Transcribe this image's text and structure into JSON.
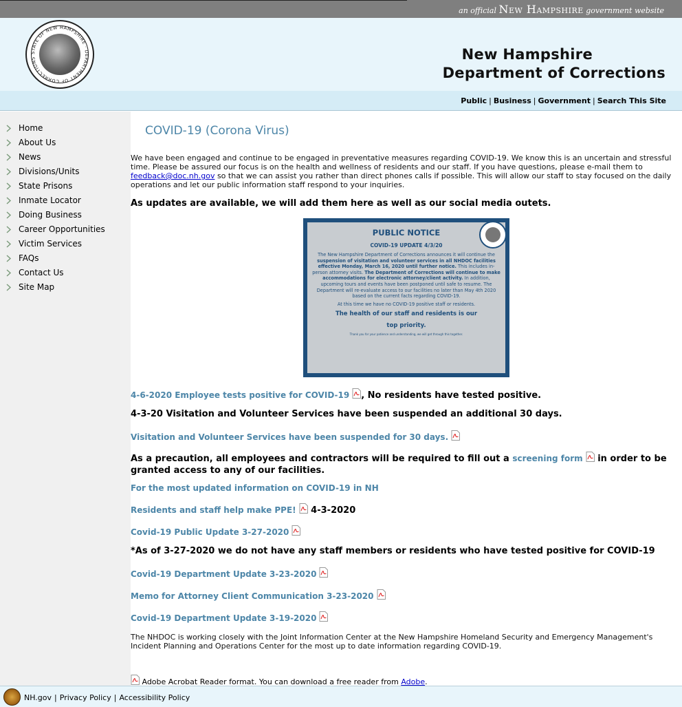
{
  "topbar": {
    "prefix": "an official",
    "state": "New Hampshire",
    "suffix": "government website"
  },
  "header": {
    "title_line1": "New Hampshire",
    "title_line2": "Department of Corrections",
    "seal_text": "STATE OF NEW HAMPSHIRE · DEPARTMENT OF CORRECTIONS"
  },
  "topnav": [
    "Public",
    "Business",
    "Government",
    "Search This Site"
  ],
  "sidebar": {
    "items": [
      "Home",
      "About Us",
      "News",
      "Divisions/Units",
      "State Prisons",
      "Inmate Locator",
      "Doing Business",
      "Career Opportunities",
      "Victim Services",
      "FAQs",
      "Contact Us",
      "Site Map"
    ]
  },
  "main": {
    "title": "COVID-19 (Corona Virus)",
    "intro_before": "We have been engaged and continue to be engaged in preventative measures regarding COVID-19. We know this is an uncertain and stressful time. Please be assured our focus is on the health and wellness of residents and our staff. If you have questions, please e-mail them to ",
    "intro_email": "feedback@doc.nh.gov",
    "intro_after": " so that we can assist you rather than direct phones calls if possible. This will allow our staff to stay focused on the daily operations and let our public information staff respond to your inquiries.",
    "updates_heading": "As updates are available, we will add them here as well as our social media outets.",
    "notice": {
      "title": "PUBLIC NOTICE",
      "update": "COVID-19 UPDATE 4/3/20",
      "p1_a": "The New Hampshire Department of Corrections announces it will continue the ",
      "p1_b": "suspension of visitation and volunteer services in all NHDOC facilities effective Monday, March 16, 2020 until further notice.",
      "p1_c": " This includes in-person attorney visits. ",
      "p1_d": "The Department of Corrections will continue to make accommodations for electronic attorney/client activity.",
      "p1_e": " In addition, upcoming tours and events have been postponed until safe to resume.  The Department will re-evaluate access to our facilities no later than May 4th 2020 based on the current facts regarding COVID-19.",
      "none": "At this time we have no COVID-19 positive staff or residents.",
      "health1": "The health of our staff and residents is our",
      "health2": "top priority.",
      "thanks": "Thank you for your patience and understanding, we will get through this together."
    },
    "item1_link": "4-6-2020 Employee tests positive for COVID-19",
    "item1_text": ", No residents have tested positive.",
    "item2_text": "4-3-20 Visitation and Volunteer Services have been suspended an additional 30 days.",
    "item3_link": "Visitation and Volunteer Services have been suspended for 30 days.",
    "item4_before": "As a precaution, all employees and contractors will be required to fill out a ",
    "item4_link": "screening form",
    "item4_after1": " in order to be",
    "item4_after2": "granted access to any of our facilities.",
    "item5_link": "For the most updated information on COVID-19 in NH",
    "item6_link": "Residents and staff help make PPE!",
    "item6_text": " 4-3-2020",
    "item7_link": "Covid-19 Public Update 3-27-2020",
    "item8_text": "*As of 3-27-2020 we do not have any staff members or residents who have tested positive for COVID-19",
    "item9_link": "Covid-19 Department Update 3-23-2020",
    "item10_link": "Memo for Attorney Client Communication 3-23-2020",
    "item11_link": "Covid-19 Department Update 3-19-2020",
    "closing": "The NHDOC is working closely with the Joint Information Center at the New Hampshire Homeland Security and Emergency Management's Incident Planning and Operations Center for the most up to date information regarding COVID-19.",
    "acrobat_before": " Adobe Acrobat Reader format. You can download a free reader from ",
    "acrobat_link": "Adobe",
    "acrobat_after": "."
  },
  "footer": {
    "links": [
      "NH.gov",
      "Privacy Policy",
      "Accessibility Policy"
    ]
  },
  "colors": {
    "link": "#4d86a8",
    "header_bg": "#e8f5fb",
    "nav_bg": "#d5ecf6",
    "sidebar_bg": "#f0f0f0",
    "notice_border": "#1f4f7c"
  }
}
